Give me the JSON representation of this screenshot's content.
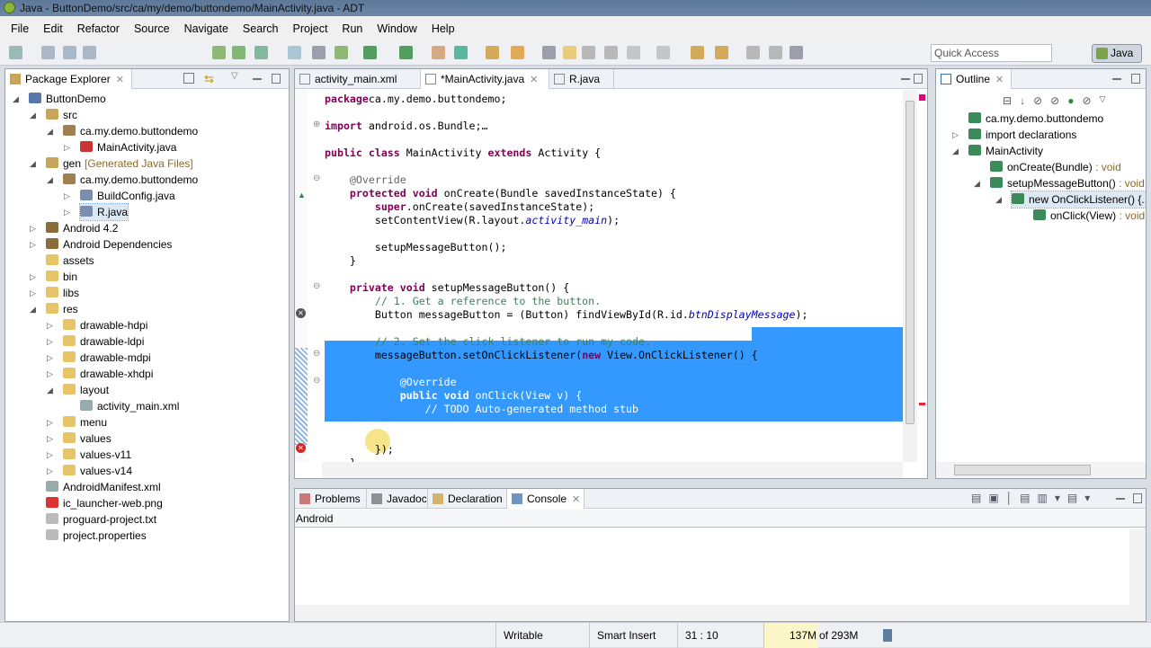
{
  "window": {
    "title": "Java - ButtonDemo/src/ca/my/demo/buttondemo/MainActivity.java - ADT"
  },
  "menu": [
    "File",
    "Edit",
    "Refactor",
    "Source",
    "Navigate",
    "Search",
    "Project",
    "Run",
    "Window",
    "Help"
  ],
  "toolbar": {
    "quick_access_placeholder": "Quick Access",
    "perspective": "Java"
  },
  "package_explorer": {
    "title": "Package Explorer",
    "items": [
      {
        "label": "ButtonDemo",
        "level": 0,
        "arrow": "open",
        "icon": "project"
      },
      {
        "label": "src",
        "level": 1,
        "arrow": "open",
        "icon": "source-folder"
      },
      {
        "label": "ca.my.demo.buttondemo",
        "level": 2,
        "arrow": "open",
        "icon": "package"
      },
      {
        "label": "MainActivity.java",
        "level": 3,
        "arrow": "closed",
        "icon": "java-file-error"
      },
      {
        "label": "gen",
        "suffix": "[Generated Java Files]",
        "level": 1,
        "arrow": "open",
        "icon": "source-folder"
      },
      {
        "label": "ca.my.demo.buttondemo",
        "level": 2,
        "arrow": "open",
        "icon": "package"
      },
      {
        "label": "BuildConfig.java",
        "level": 3,
        "arrow": "closed",
        "icon": "java-file"
      },
      {
        "label": "R.java",
        "level": 3,
        "arrow": "closed",
        "icon": "java-file",
        "selected": true
      },
      {
        "label": "Android 4.2",
        "level": 1,
        "arrow": "closed",
        "icon": "library"
      },
      {
        "label": "Android Dependencies",
        "level": 1,
        "arrow": "closed",
        "icon": "library"
      },
      {
        "label": "assets",
        "level": 1,
        "arrow": "none",
        "icon": "folder"
      },
      {
        "label": "bin",
        "level": 1,
        "arrow": "closed",
        "icon": "folder"
      },
      {
        "label": "libs",
        "level": 1,
        "arrow": "closed",
        "icon": "folder"
      },
      {
        "label": "res",
        "level": 1,
        "arrow": "open",
        "icon": "folder"
      },
      {
        "label": "drawable-hdpi",
        "level": 2,
        "arrow": "closed",
        "icon": "folder"
      },
      {
        "label": "drawable-ldpi",
        "level": 2,
        "arrow": "closed",
        "icon": "folder"
      },
      {
        "label": "drawable-mdpi",
        "level": 2,
        "arrow": "closed",
        "icon": "folder"
      },
      {
        "label": "drawable-xhdpi",
        "level": 2,
        "arrow": "closed",
        "icon": "folder"
      },
      {
        "label": "layout",
        "level": 2,
        "arrow": "open",
        "icon": "folder"
      },
      {
        "label": "activity_main.xml",
        "level": 3,
        "arrow": "none",
        "icon": "xml-file"
      },
      {
        "label": "menu",
        "level": 2,
        "arrow": "closed",
        "icon": "folder"
      },
      {
        "label": "values",
        "level": 2,
        "arrow": "closed",
        "icon": "folder"
      },
      {
        "label": "values-v11",
        "level": 2,
        "arrow": "closed",
        "icon": "folder"
      },
      {
        "label": "values-v14",
        "level": 2,
        "arrow": "closed",
        "icon": "folder"
      },
      {
        "label": "AndroidManifest.xml",
        "level": 1,
        "arrow": "none",
        "icon": "xml-file"
      },
      {
        "label": "ic_launcher-web.png",
        "level": 1,
        "arrow": "none",
        "icon": "image-file"
      },
      {
        "label": "proguard-project.txt",
        "level": 1,
        "arrow": "none",
        "icon": "text-file"
      },
      {
        "label": "project.properties",
        "level": 1,
        "arrow": "none",
        "icon": "text-file"
      }
    ]
  },
  "editor": {
    "tabs": [
      {
        "label": "activity_main.xml"
      },
      {
        "label": "*MainActivity.java",
        "active": true
      },
      {
        "label": "R.java"
      }
    ],
    "lines": [
      [
        [
          "kw",
          "package"
        ],
        [
          "",
          "ca.my.demo.buttondemo;"
        ]
      ],
      [],
      [
        [
          "kw",
          "import"
        ],
        [
          "",
          " android.os.Bundle;"
        ],
        [
          "",
          "…"
        ]
      ],
      [],
      [
        [
          "kw",
          "public class"
        ],
        [
          "",
          " MainActivity "
        ],
        [
          "kw",
          "extends"
        ],
        [
          "",
          " Activity {"
        ]
      ],
      [],
      [
        [
          "an",
          "    @Override"
        ]
      ],
      [
        [
          "",
          "    "
        ],
        [
          "kw",
          "protected void"
        ],
        [
          "",
          " onCreate(Bundle savedInstanceState) {"
        ]
      ],
      [
        [
          "",
          "        "
        ],
        [
          "kw",
          "super"
        ],
        [
          "",
          ".onCreate(savedInstanceState);"
        ]
      ],
      [
        [
          "",
          "        setContentView(R.layout."
        ],
        [
          "it",
          "activity_main"
        ],
        [
          "",
          ");"
        ]
      ],
      [],
      [
        [
          "",
          "        setupMessageButton();"
        ]
      ],
      [
        [
          "",
          "    }"
        ]
      ],
      [],
      [
        [
          "",
          "    "
        ],
        [
          "kw",
          "private void"
        ],
        [
          "",
          " setupMessageButton() {"
        ]
      ],
      [
        [
          "cm",
          "        // 1. Get a reference to the button."
        ]
      ],
      [
        [
          "",
          "        Button messageButton = (Button) findViewById(R.id."
        ],
        [
          "it",
          "btnDisplayMessage"
        ],
        [
          "",
          ");"
        ]
      ],
      [],
      [
        [
          "cm",
          "        // 2. Set the click listener to run my code."
        ]
      ],
      [
        [
          "",
          "        messageButton.setOnClickListener("
        ],
        [
          "kw",
          "new"
        ],
        [
          "",
          " View.OnClickListener() {"
        ]
      ],
      [],
      [
        [
          "an",
          "            @Override"
        ]
      ],
      [
        [
          "",
          "            "
        ],
        [
          "kw",
          "public void"
        ],
        [
          "",
          " onClick(View v) {"
        ]
      ],
      [
        [
          "cm",
          "                // TODO Auto-generated method stub"
        ]
      ],
      [],
      [
        [
          "",
          "            }"
        ]
      ],
      [
        [
          "",
          "        });"
        ]
      ],
      [
        [
          "",
          "    }"
        ]
      ]
    ]
  },
  "outline": {
    "title": "Outline",
    "items": [
      {
        "label": "ca.my.demo.buttondemo",
        "level": 0,
        "arrow": "none"
      },
      {
        "label": "import declarations",
        "level": 0,
        "arrow": "closed"
      },
      {
        "label": "MainActivity",
        "level": 0,
        "arrow": "open"
      },
      {
        "label": "onCreate(Bundle)",
        "type": " : void",
        "level": 1,
        "arrow": "none"
      },
      {
        "label": "setupMessageButton()",
        "type": " : void",
        "level": 1,
        "arrow": "open"
      },
      {
        "label": "new OnClickListener() {...}",
        "level": 2,
        "arrow": "open",
        "selected": true
      },
      {
        "label": "onClick(View)",
        "type": " : void",
        "level": 3,
        "arrow": "none"
      }
    ]
  },
  "bottom": {
    "tabs": [
      {
        "label": "Problems"
      },
      {
        "label": "Javadoc"
      },
      {
        "label": "Declaration"
      },
      {
        "label": "Console",
        "active": true
      }
    ],
    "console_name": "Android"
  },
  "status": {
    "writable": "Writable",
    "insert_mode": "Smart Insert",
    "position": "31 : 10",
    "heap_used": "137M",
    "heap_total": "of 293M",
    "heap_fraction": 0.47
  }
}
